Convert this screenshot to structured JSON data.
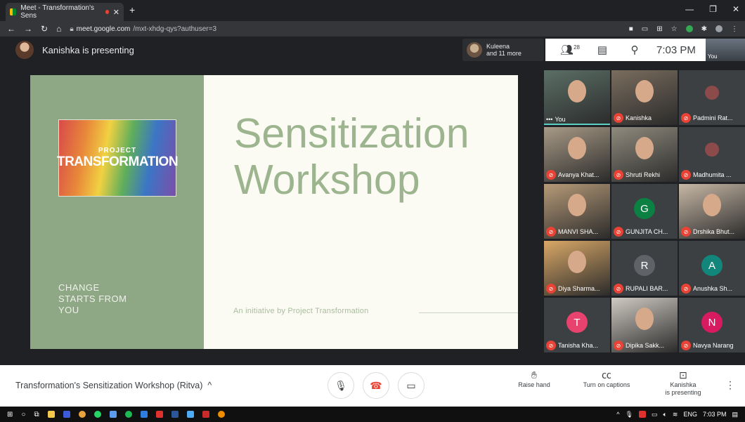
{
  "browser": {
    "tab_title": "Meet - Transformation's Sens",
    "url_domain": "meet.google.com",
    "url_path": "/mxt-xhdg-qys?authuser=3"
  },
  "header": {
    "presenting_label": "Kanishka is presenting",
    "others_name": "Kuleena",
    "others_more": "and 11 more",
    "participant_count": "28",
    "time": "7:03 PM",
    "self_label": "You"
  },
  "slide": {
    "logo_line1": "PROJECT",
    "logo_line2": "TRANSFORMATION",
    "tagline": [
      "CHANGE",
      "STARTS FROM",
      "YOU"
    ],
    "title_line1": "Sensitization",
    "title_line2": "Workshop",
    "initiative": "An initiative by Project Transformation"
  },
  "participants": [
    {
      "name": "You",
      "muted": false,
      "letter": "",
      "color": "#5b6f66"
    },
    {
      "name": "Kanishka",
      "muted": true,
      "letter": "",
      "color": "#7a6d5e"
    },
    {
      "name": "Padmini Rat...",
      "muted": true,
      "letter": "",
      "color": "#3c4043"
    },
    {
      "name": "Avanya Khat...",
      "muted": true,
      "letter": "",
      "color": "#a89a86"
    },
    {
      "name": "Shruti Rekhi",
      "muted": true,
      "letter": "",
      "color": "#8f8a7d"
    },
    {
      "name": "Madhumita ...",
      "muted": true,
      "letter": "",
      "color": "#3c4043"
    },
    {
      "name": "MANVI SHA...",
      "muted": true,
      "letter": "",
      "color": "#b69a78"
    },
    {
      "name": "GUNJITA CH...",
      "muted": true,
      "letter": "G",
      "color": "#0b8043"
    },
    {
      "name": "Drshika Bhut...",
      "muted": true,
      "letter": "",
      "color": "#c7b8a6"
    },
    {
      "name": "Diya Sharma...",
      "muted": true,
      "letter": "",
      "color": "#d9a867"
    },
    {
      "name": "RUPALI BAR...",
      "muted": true,
      "letter": "R",
      "color": "#5f6368"
    },
    {
      "name": "Anushka Sh...",
      "muted": true,
      "letter": "A",
      "color": "#12867a"
    },
    {
      "name": "Tanisha Kha...",
      "muted": true,
      "letter": "T",
      "color": "#e8436f"
    },
    {
      "name": "Dipika Sakk...",
      "muted": true,
      "letter": "",
      "color": "#cfcac2"
    },
    {
      "name": "Navya Narang",
      "muted": true,
      "letter": "N",
      "color": "#d81b60"
    }
  ],
  "bottom": {
    "meeting_title": "Transformation's Sensitization Workshop (Ritva)",
    "raise_hand": "Raise hand",
    "captions": "Turn on captions",
    "presenting_line1": "Kanishka",
    "presenting_line2": "is presenting"
  },
  "taskbar": {
    "lang": "ENG",
    "time": "7:03 PM"
  }
}
